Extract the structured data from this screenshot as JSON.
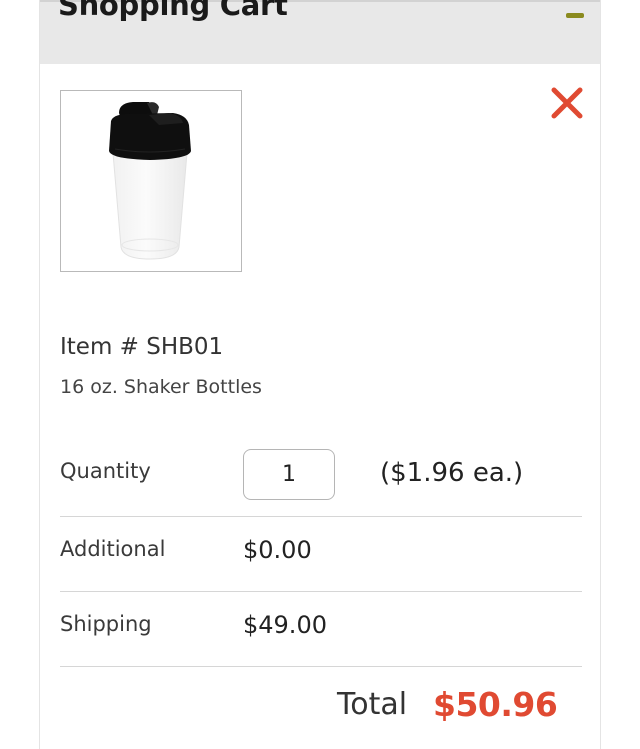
{
  "cart": {
    "title": "Shopping Cart",
    "collapse_icon": "minus-icon",
    "remove_icon": "close-icon",
    "accent_color": "#8a8a1e",
    "remove_color": "#e04a32"
  },
  "item": {
    "image_icon": "shaker-bottle-image",
    "number": "Item # SHB01",
    "description": "16 oz. Shaker Bottles"
  },
  "quantity": {
    "label": "Quantity",
    "value": "1",
    "unit_price": "($1.96 ea.)"
  },
  "additional": {
    "label": "Additional",
    "value": "$0.00"
  },
  "shipping": {
    "label": "Shipping",
    "value": "$49.00"
  },
  "total": {
    "label": "Total",
    "value": "$50.96",
    "color": "#e04a32"
  }
}
